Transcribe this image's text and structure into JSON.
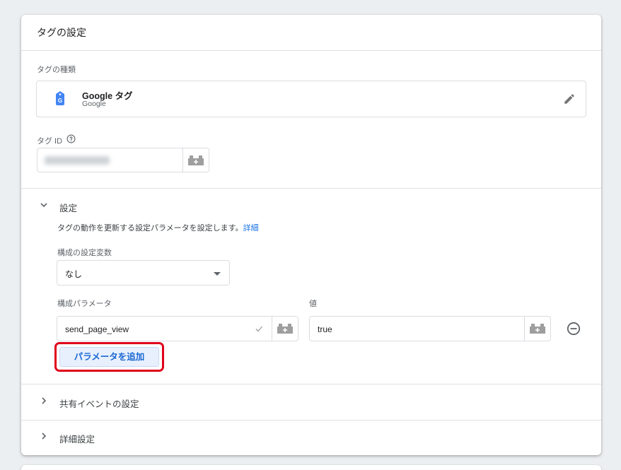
{
  "card": {
    "title": "タグの設定",
    "tag_type": {
      "label": "タグの種類",
      "name": "Google タグ",
      "vendor": "Google",
      "icon": "google-tag-icon"
    },
    "tag_id": {
      "label": "タグ ID",
      "help_icon": "help-circle-icon",
      "variable_icon": "variable-brick-icon"
    },
    "settings": {
      "title": "設定",
      "description": "タグの動作を更新する設定パラメータを設定します。",
      "details_link": "詳細",
      "config_variable_label": "構成の設定変数",
      "config_variable_value": "なし",
      "param_header": "構成パラメータ",
      "value_header": "値",
      "parameters": [
        {
          "name": "send_page_view",
          "value": "true"
        }
      ],
      "add_button": "パラメータを追加"
    },
    "shared_events": {
      "title": "共有イベントの設定"
    },
    "advanced": {
      "title": "詳細設定"
    }
  },
  "colors": {
    "accent": "#1a73e8",
    "highlight_outline": "#e0001b",
    "add_button_bg": "#e8f0fe"
  }
}
